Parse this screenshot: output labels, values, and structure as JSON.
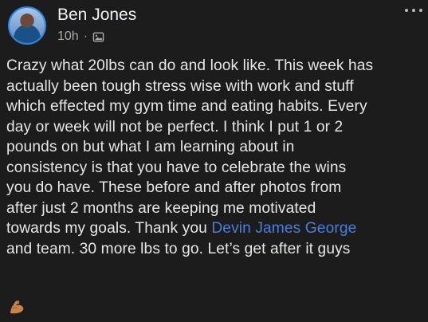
{
  "post": {
    "author": "Ben Jones",
    "time": "10h",
    "audience_icon": "photo-icon",
    "menu_icon": "more-options-icon",
    "lines": [
      "Crazy what 20lbs can do and look like. This week has",
      "actually been tough stress wise with work and stuff",
      "which effected my gym time and eating habits. Every",
      "day or week will not be perfect. I think I put 1 or 2",
      "pounds on but what I am learning about in",
      "consistency is that you have to celebrate the wins",
      "you do have. These before and after photos from",
      "after just 2 months are keeping me motivated",
      "towards my goals. Thank you "
    ],
    "mention": "Devin James George",
    "last_line": "and team. 30 more lbs to go. Let’s get after it guys",
    "emoji": "flexed-biceps-emoji"
  },
  "colors": {
    "background": "#1c1c1d",
    "text": "#e5e6e7",
    "secondary_text": "#a8abb0",
    "mention": "#4b7dd8"
  }
}
